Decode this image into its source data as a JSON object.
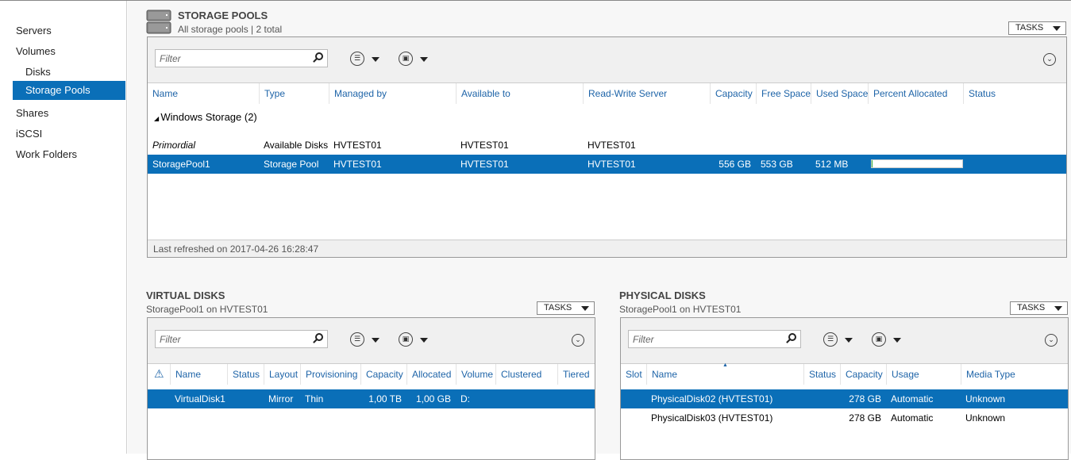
{
  "sidebar": {
    "items": [
      {
        "label": "Servers",
        "sub": false,
        "selected": false
      },
      {
        "label": "Volumes",
        "sub": false,
        "selected": false
      },
      {
        "label": "Disks",
        "sub": true,
        "selected": false
      },
      {
        "label": "Storage Pools",
        "sub": true,
        "selected": true
      },
      {
        "label": "Shares",
        "sub": false,
        "selected": false
      },
      {
        "label": "iSCSI",
        "sub": false,
        "selected": false
      },
      {
        "label": "Work Folders",
        "sub": false,
        "selected": false
      }
    ]
  },
  "colors": {
    "selection": "#0a6fb8",
    "header_text": "#1e64a8",
    "progress_fill": "#3bb03b"
  },
  "pools": {
    "title": "STORAGE POOLS",
    "subtitle": "All storage pools | 2 total",
    "tasks": "TASKS",
    "filter_placeholder": "Filter",
    "columns": [
      "Name",
      "Type",
      "Managed by",
      "Available to",
      "Read-Write Server",
      "Capacity",
      "Free Space",
      "Used Space",
      "Percent Allocated",
      "Status"
    ],
    "group": "Windows Storage (2)",
    "rows": [
      {
        "cells": [
          "Primordial",
          "Available Disks",
          "HVTEST01",
          "HVTEST01",
          "HVTEST01",
          "",
          "",
          "",
          "",
          ""
        ],
        "italic": true,
        "selected": false
      },
      {
        "cells": [
          "StoragePool1",
          "Storage Pool",
          "HVTEST01",
          "HVTEST01",
          "HVTEST01",
          "556 GB",
          "553 GB",
          "512 MB",
          "",
          ""
        ],
        "italic": false,
        "selected": true,
        "percent_allocated": 1
      }
    ],
    "footer": "Last refreshed on 2017-04-26 16:28:47"
  },
  "virtual": {
    "title": "VIRTUAL DISKS",
    "subtitle": "StoragePool1 on HVTEST01",
    "tasks": "TASKS",
    "filter_placeholder": "Filter",
    "columns": [
      "",
      "Name",
      "Status",
      "Layout",
      "Provisioning",
      "Capacity",
      "Allocated",
      "Volume",
      "Clustered",
      "Tiered"
    ],
    "rows": [
      {
        "cells": [
          "",
          "VirtualDisk1",
          "",
          "Mirror",
          "Thin",
          "1,00 TB",
          "1,00 GB",
          "D:",
          "",
          ""
        ],
        "selected": true
      }
    ]
  },
  "physical": {
    "title": "PHYSICAL DISKS",
    "subtitle": "StoragePool1 on HVTEST01",
    "tasks": "TASKS",
    "filter_placeholder": "Filter",
    "columns": [
      "Slot",
      "Name",
      "Status",
      "Capacity",
      "Usage",
      "Media Type"
    ],
    "rows": [
      {
        "cells": [
          "",
          "PhysicalDisk02 (HVTEST01)",
          "",
          "278 GB",
          "Automatic",
          "Unknown"
        ],
        "selected": true
      },
      {
        "cells": [
          "",
          "PhysicalDisk03 (HVTEST01)",
          "",
          "278 GB",
          "Automatic",
          "Unknown"
        ],
        "selected": false
      }
    ]
  }
}
